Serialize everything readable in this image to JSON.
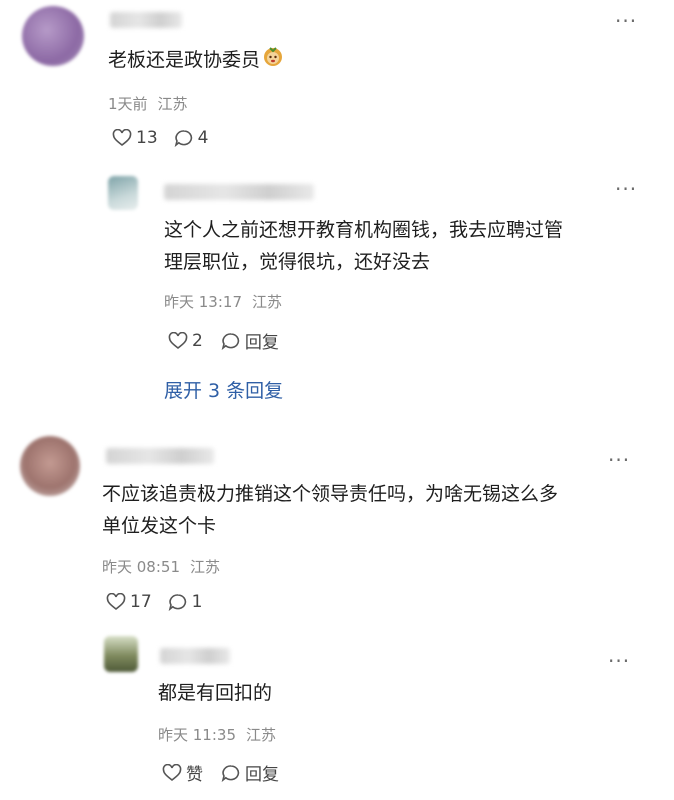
{
  "colors": {
    "link": "#2f5fa6",
    "meta": "#8a8a8a",
    "text": "#1e1e1e"
  },
  "comments": [
    {
      "text": "老板还是政协委员",
      "emoji": "monkey-emoji",
      "time": "1天前",
      "location": "江苏",
      "likes": "13",
      "replies": "4",
      "reply": {
        "text_line1": "这个人之前还想开教育机构圈钱，我去应聘过管",
        "text_line2": "理层职位，觉得很坑，还好没去",
        "time": "昨天 13:17",
        "location": "江苏",
        "likes": "2",
        "reply_label": "回复"
      },
      "expand_label": "展开 3 条回复"
    },
    {
      "text_line1": "不应该追责极力推销这个领导责任吗，为啥无锡这么多",
      "text_line2": "单位发这个卡",
      "time": "昨天 08:51",
      "location": "江苏",
      "likes": "17",
      "replies": "1",
      "reply": {
        "text": "都是有回扣的",
        "time": "昨天 11:35",
        "location": "江苏",
        "like_label": "赞",
        "reply_label": "回复"
      }
    }
  ]
}
